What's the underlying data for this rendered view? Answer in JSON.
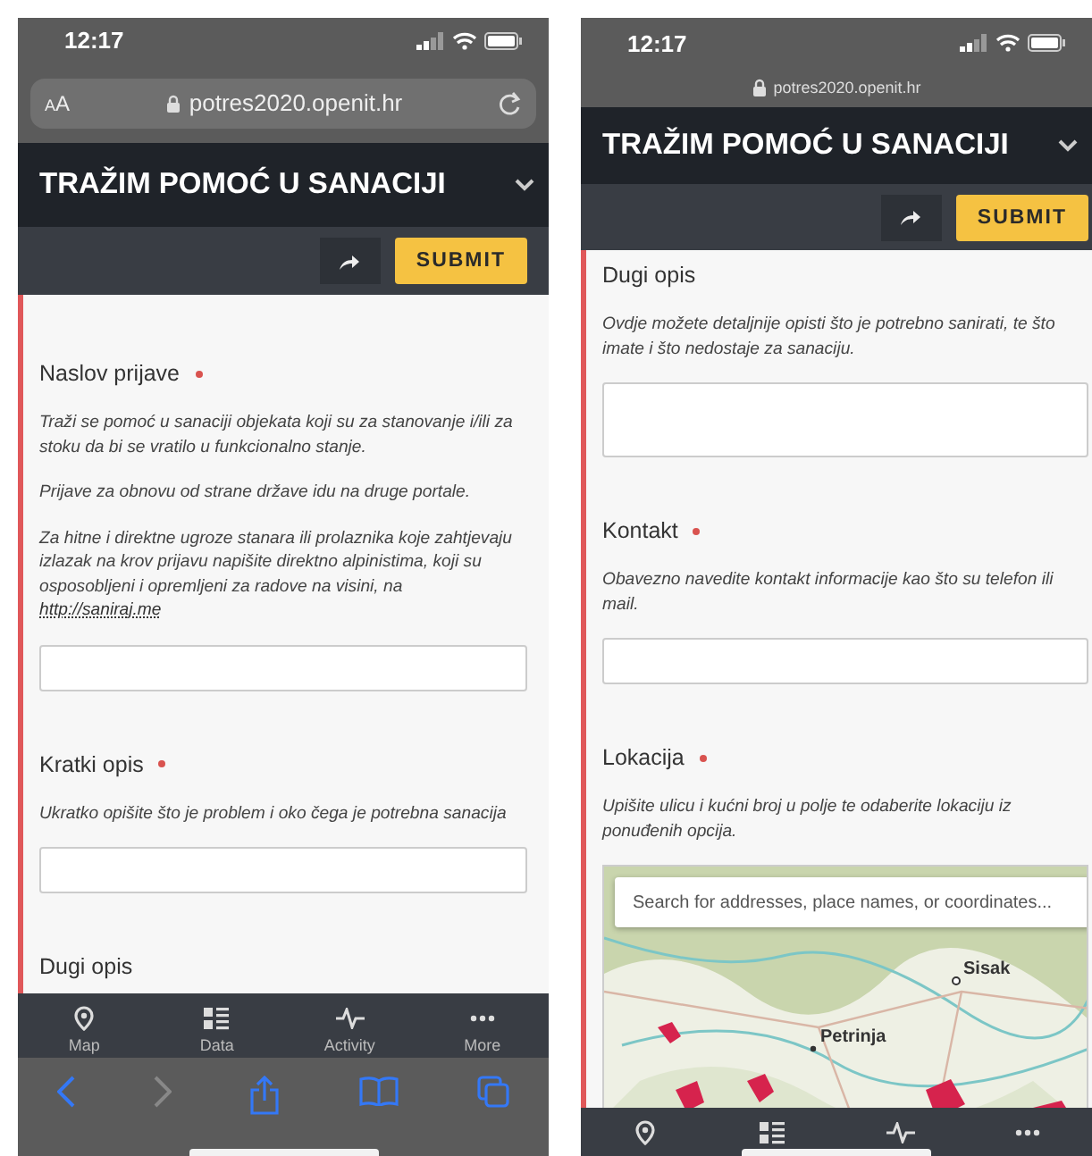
{
  "phones": [
    {
      "kind": "full_url",
      "status_bar": {
        "time": "12:17"
      },
      "address_bar": {
        "text_size": "AA",
        "url": "potres2020.openit.hr"
      },
      "header": {
        "title": "TRAŽIM POMOĆ U SANACIJI"
      },
      "toolbar": {
        "submit": "SUBMIT"
      },
      "fields": [
        {
          "label": "Naslov prijave",
          "required": true,
          "help": [
            "Traži se pomoć u sanaciji objekata koji su za stanovanje i/ili za stoku da bi se vratilo u funkcionalno stanje.",
            "Prijave za obnovu od strane države idu na druge portale.",
            {
              "text": "Za hitne i direktne ugroze stanara ili prolaznika koje zahtjevaju izlazak na krov prijavu napišite direktno alpinistima, koji su osposobljeni i opremljeni za radove na visini, na ",
              "link": "http://saniraj.me"
            }
          ],
          "kind": "text"
        },
        {
          "label": "Kratki opis",
          "required": true,
          "help": [
            "Ukratko opišite što je problem i oko čega je potrebna sanacija"
          ],
          "kind": "text"
        },
        {
          "label": "Dugi opis",
          "required": false
        }
      ],
      "tabs": [
        {
          "kind": "map",
          "label": "Map"
        },
        {
          "kind": "data",
          "label": "Data"
        },
        {
          "kind": "activity",
          "label": "Activity"
        },
        {
          "kind": "more",
          "label": "More"
        }
      ],
      "safari_toolbar": [
        {
          "kind": "back",
          "disabled": false
        },
        {
          "kind": "forward",
          "disabled": true
        },
        {
          "kind": "share",
          "disabled": false
        },
        {
          "kind": "bookmarks",
          "disabled": false
        },
        {
          "kind": "tabs",
          "disabled": false
        }
      ]
    },
    {
      "kind": "compact_url",
      "status_bar": {
        "time": "12:17"
      },
      "address_bar": {
        "url": "potres2020.openit.hr"
      },
      "header": {
        "title": "TRAŽIM POMOĆ U SANACIJI"
      },
      "toolbar": {
        "submit": "SUBMIT"
      },
      "fields": [
        {
          "label": "Dugi opis",
          "required": false,
          "help": [
            "Ovdje možete detaljnije opisti što je potrebno sanirati, te što imate i što nedostaje za sanaciju."
          ],
          "kind": "textarea"
        },
        {
          "label": "Kontakt",
          "required": true,
          "help": [
            "Obavezno navedite kontakt informacije kao što su telefon ili mail."
          ],
          "kind": "text"
        },
        {
          "label": "Lokacija",
          "required": true,
          "help": [
            "Upišite ulicu i kućni broj u polje te odaberite lokaciju iz ponuđenih opcija."
          ],
          "kind": "map",
          "map": {
            "search_placeholder": "Search for addresses, place names, or coordinates...",
            "labels": [
              "Sisak",
              "Petrinja"
            ]
          }
        }
      ],
      "tabs": [
        {
          "kind": "map"
        },
        {
          "kind": "data"
        },
        {
          "kind": "activity"
        },
        {
          "kind": "more"
        }
      ]
    }
  ]
}
